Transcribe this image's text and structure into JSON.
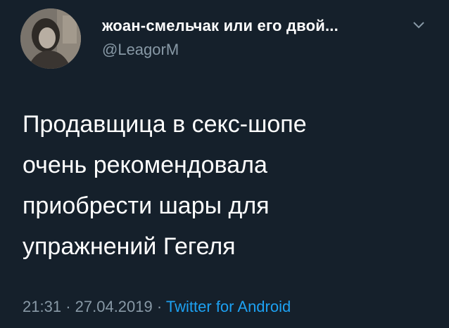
{
  "tweet": {
    "display_name": "жоан-смельчак или его двой...",
    "handle": "@LeagorM",
    "text_lines": [
      "Продавщица в секс-шопе",
      "очень рекомендовала",
      "приобрести шары для",
      "упражнений Гегеля"
    ],
    "time": "21:31",
    "separator": "·",
    "date": "27.04.2019",
    "source": "Twitter for Android"
  },
  "icons": {
    "avatar": "avatar-photo",
    "menu": "chevron-down-icon"
  },
  "colors": {
    "background": "#15202b",
    "text": "#ffffff",
    "secondary": "#8899a6",
    "link": "#1da1f2"
  }
}
